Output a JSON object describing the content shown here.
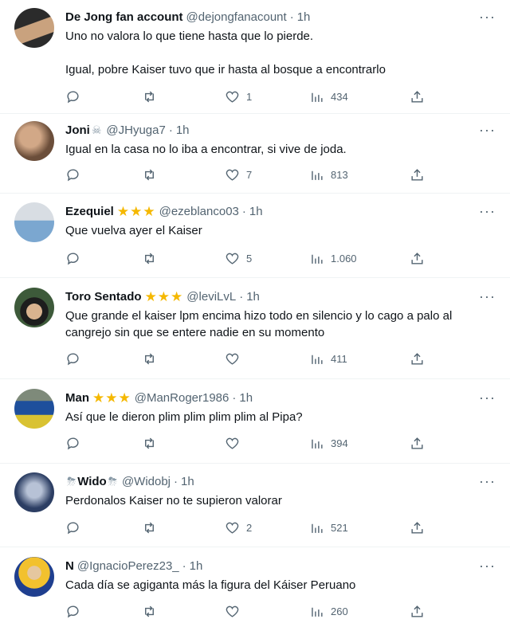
{
  "tweets": [
    {
      "name": "De Jong fan account",
      "stars": "",
      "emoji_pre": "",
      "emoji_post": "",
      "handle": "@dejongfanacount",
      "time": "1h",
      "body": "Uno no valora lo que tiene hasta que lo pierde.\n\nIgual, pobre Kaiser tuvo que ir hasta al bosque a encontrarlo",
      "likes": "1",
      "views": "434",
      "avatar_colors": [
        "#2b2b2b",
        "#c9a27e"
      ]
    },
    {
      "name": "Joni",
      "stars": "",
      "emoji_pre": "",
      "emoji_post": "☠",
      "handle": "@JHyuga7",
      "time": "1h",
      "body": "Igual en la casa no lo iba a encontrar, si vive de joda.",
      "likes": "7",
      "views": "813",
      "avatar_colors": [
        "#6b4e3a",
        "#d2a887"
      ]
    },
    {
      "name": "Ezequiel",
      "stars": "★★★",
      "emoji_pre": "",
      "emoji_post": "",
      "handle": "@ezeblanco03",
      "time": "1h",
      "body": "Que vuelva ayer el Kaiser",
      "likes": "5",
      "views": "1.060",
      "avatar_colors": [
        "#d8dde3",
        "#7ba7d0"
      ]
    },
    {
      "name": "Toro Sentado",
      "stars": "★★★",
      "emoji_pre": "",
      "emoji_post": "",
      "handle": "@leviLvL",
      "time": "1h",
      "body": "Que grande el kaiser lpm encima hizo todo en silencio y lo cago a palo al cangrejo sin que se entere nadie en su momento",
      "likes": "",
      "views": "411",
      "avatar_colors": [
        "#3d5a3a",
        "#1d1d1d"
      ]
    },
    {
      "name": "Man",
      "stars": "★★★",
      "emoji_pre": "",
      "emoji_post": "",
      "handle": "@ManRoger1986",
      "time": "1h",
      "body": "Así que le dieron plim plim plim plim al Pipa?",
      "likes": "",
      "views": "394",
      "avatar_colors": [
        "#1e4f9c",
        "#d9c232"
      ]
    },
    {
      "name": "Wido",
      "stars": "",
      "emoji_pre": "⛈",
      "emoji_post": "⛈",
      "handle": "@Widobj",
      "time": "1h",
      "body": "Perdonalos Kaiser no te supieron valorar",
      "likes": "2",
      "views": "521",
      "avatar_colors": [
        "#2c3e63",
        "#b7c2d6"
      ]
    },
    {
      "name": "N",
      "stars": "",
      "emoji_pre": "",
      "emoji_post": "",
      "handle": "@IgnacioPerez23_",
      "time": "1h",
      "body": "Cada día se agiganta más la figura del Káiser Peruano",
      "likes": "",
      "views": "260",
      "avatar_colors": [
        "#f2c12e",
        "#1f3f8f"
      ]
    }
  ],
  "colors": {
    "secondary_text": "#536471",
    "divider": "#eff3f4",
    "star": "#f5b800"
  }
}
